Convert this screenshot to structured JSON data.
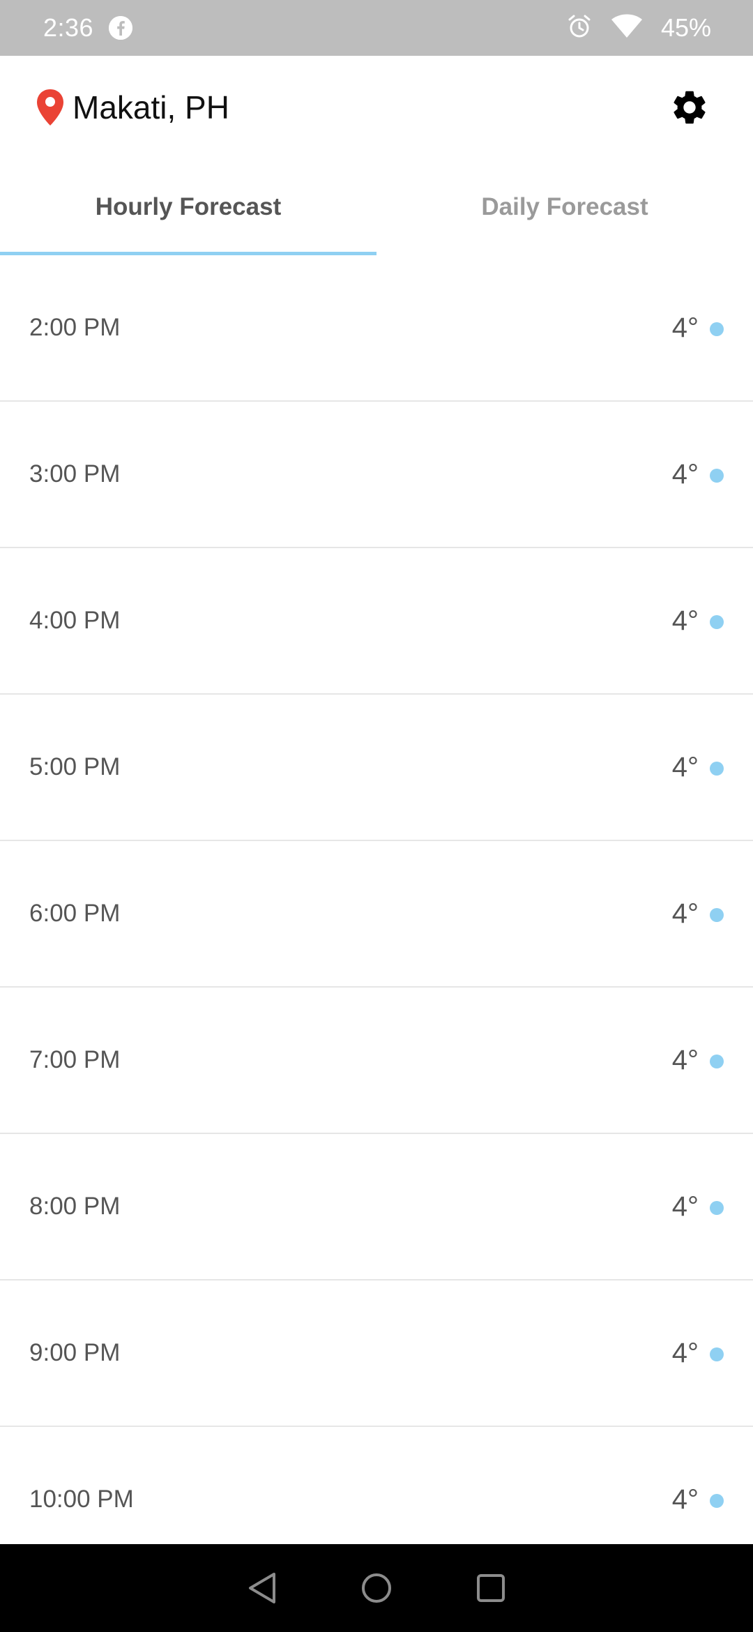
{
  "status_bar": {
    "time": "2:36",
    "battery": "45%",
    "icons": [
      "facebook-icon",
      "alarm-icon",
      "wifi-icon"
    ]
  },
  "header": {
    "location": "Makati, PH",
    "location_icon": "map-pin-icon",
    "settings_icon": "gear-icon"
  },
  "tabs": [
    {
      "label": "Hourly Forecast",
      "active": true
    },
    {
      "label": "Daily Forecast",
      "active": false
    }
  ],
  "forecast": [
    {
      "time": "2:00 PM",
      "temp": "4°"
    },
    {
      "time": "3:00 PM",
      "temp": "4°"
    },
    {
      "time": "4:00 PM",
      "temp": "4°"
    },
    {
      "time": "5:00 PM",
      "temp": "4°"
    },
    {
      "time": "6:00 PM",
      "temp": "4°"
    },
    {
      "time": "7:00 PM",
      "temp": "4°"
    },
    {
      "time": "8:00 PM",
      "temp": "4°"
    },
    {
      "time": "9:00 PM",
      "temp": "4°"
    },
    {
      "time": "10:00 PM",
      "temp": "4°"
    }
  ],
  "nav": [
    "back-icon",
    "home-icon",
    "recents-icon"
  ],
  "colors": {
    "accent": "#8fd0f2",
    "status_bar": "#bdbdbd",
    "pin": "#ea4335"
  }
}
